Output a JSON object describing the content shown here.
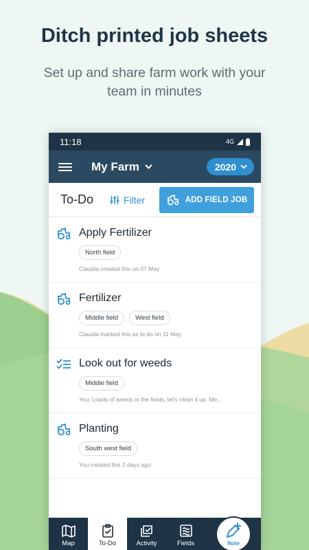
{
  "promo": {
    "title": "Ditch printed job sheets",
    "subtitle": "Set up and share farm work with your team in minutes"
  },
  "status_bar": {
    "time": "11:18",
    "network": "4G"
  },
  "app_bar": {
    "farm_name": "My Farm",
    "year": "2020"
  },
  "toolbar": {
    "title": "To-Do",
    "filter_label": "Filter",
    "add_job_label": "ADD FIELD JOB"
  },
  "jobs": [
    {
      "title": "Apply Fertilizer",
      "icon": "tractor-icon",
      "tags": [
        "North field"
      ],
      "meta": "Claudia created this on 07 May"
    },
    {
      "title": "Fertilizer",
      "icon": "tractor-icon",
      "tags": [
        "Middle field",
        "West field"
      ],
      "meta": "Claudia marked this as to do on 11 May"
    },
    {
      "title": "Look out for weeds",
      "icon": "checklist-icon",
      "tags": [
        "Middle field"
      ],
      "meta": "You: Loads of weeds in the fields, let's clean it up. Me..."
    },
    {
      "title": "Planting",
      "icon": "tractor-icon",
      "tags": [
        "South west field"
      ],
      "meta": "You created this 2 days ago"
    }
  ],
  "bottom_nav": [
    {
      "label": "Map",
      "icon": "map-icon"
    },
    {
      "label": "To-Do",
      "icon": "clipboard-icon"
    },
    {
      "label": "Activity",
      "icon": "activity-icon"
    },
    {
      "label": "Fields",
      "icon": "fields-icon"
    }
  ],
  "fab": {
    "label": "Note",
    "icon": "note-add-icon"
  },
  "colors": {
    "primary_dark": "#1e3346",
    "app_bar": "#2b4a62",
    "accent_blue": "#2f8fd0",
    "button_blue": "#3fa0dd",
    "hill_green": "#9ccf90",
    "hill_yellow": "#ecdca4"
  }
}
